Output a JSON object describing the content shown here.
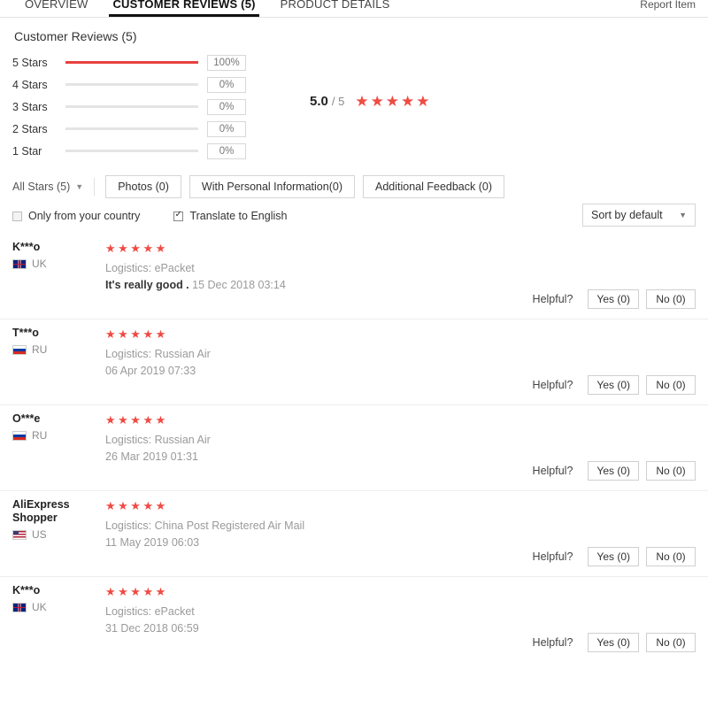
{
  "tabs": [
    {
      "label": "OVERVIEW",
      "active": false
    },
    {
      "label": "CUSTOMER REVIEWS (5)",
      "active": true
    },
    {
      "label": "PRODUCT DETAILS",
      "active": false
    }
  ],
  "report_item": "Report Item",
  "section_title": "Customer Reviews (5)",
  "rating_summary": {
    "score": "5.0",
    "score_denominator": "/ 5",
    "stars_filled": 5,
    "accent_color": "#e8413f",
    "distribution": [
      {
        "label": "5 Stars",
        "percent": "100%",
        "value": 100
      },
      {
        "label": "4 Stars",
        "percent": "0%",
        "value": 0
      },
      {
        "label": "3 Stars",
        "percent": "0%",
        "value": 0
      },
      {
        "label": "2 Stars",
        "percent": "0%",
        "value": 0
      },
      {
        "label": "1 Star",
        "percent": "0%",
        "value": 0
      }
    ]
  },
  "filters": {
    "all_stars": "All Stars (5)",
    "buttons": [
      "Photos (0)",
      "With Personal Information(0)",
      "Additional Feedback (0)"
    ]
  },
  "checkboxes": [
    {
      "label": "Only from your country",
      "checked": false
    },
    {
      "label": "Translate to English",
      "checked": true
    }
  ],
  "sort": {
    "value": "Sort by default"
  },
  "helpful": {
    "label": "Helpful?",
    "yes": "Yes (0)",
    "no": "No (0)"
  },
  "reviews": [
    {
      "name": "K***o",
      "country": "UK",
      "flag": "uk",
      "stars": 5,
      "logistics": "Logistics: ePacket",
      "comment": "It's really good .",
      "date": "15 Dec 2018 03:14"
    },
    {
      "name": "T***o",
      "country": "RU",
      "flag": "ru",
      "stars": 5,
      "logistics": "Logistics: Russian Air",
      "comment": "",
      "date": "06 Apr 2019 07:33"
    },
    {
      "name": "O***e",
      "country": "RU",
      "flag": "ru",
      "stars": 5,
      "logistics": "Logistics: Russian Air",
      "comment": "",
      "date": "26 Mar 2019 01:31"
    },
    {
      "name": "AliExpress Shopper",
      "country": "US",
      "flag": "us",
      "stars": 5,
      "logistics": "Logistics: China Post Registered Air Mail",
      "comment": "",
      "date": "11 May 2019 06:03"
    },
    {
      "name": "K***o",
      "country": "UK",
      "flag": "uk",
      "stars": 5,
      "logistics": "Logistics: ePacket",
      "comment": "",
      "date": "31 Dec 2018 06:59"
    }
  ]
}
